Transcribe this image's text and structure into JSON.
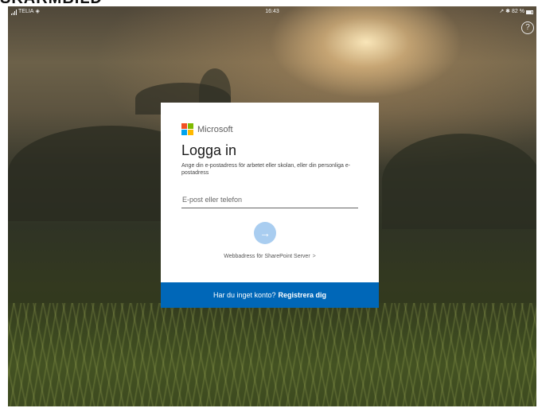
{
  "top_crop_text": "SKÄRMBILD",
  "status_bar": {
    "carrier": "TELIA",
    "time": "16:43",
    "indicators": "↗ ✱",
    "battery": "82 %"
  },
  "help": {
    "label": "?"
  },
  "login": {
    "brand": "Microsoft",
    "brand_colors": [
      "#f25022",
      "#7fba00",
      "#00a4ef",
      "#ffb900"
    ],
    "title": "Logga in",
    "description": "Ange din e-postadress för arbetet eller skolan, eller din personliga e-postadress",
    "email_placeholder": "E-post eller telefon",
    "next_icon": "arrow-right-icon",
    "sharepoint_link": "Webbadress för SharePoint Server",
    "sharepoint_chevron": ">",
    "no_account_text": "Har du inget konto?",
    "register_link": "Registrera dig",
    "accent_color": "#0067b8"
  }
}
